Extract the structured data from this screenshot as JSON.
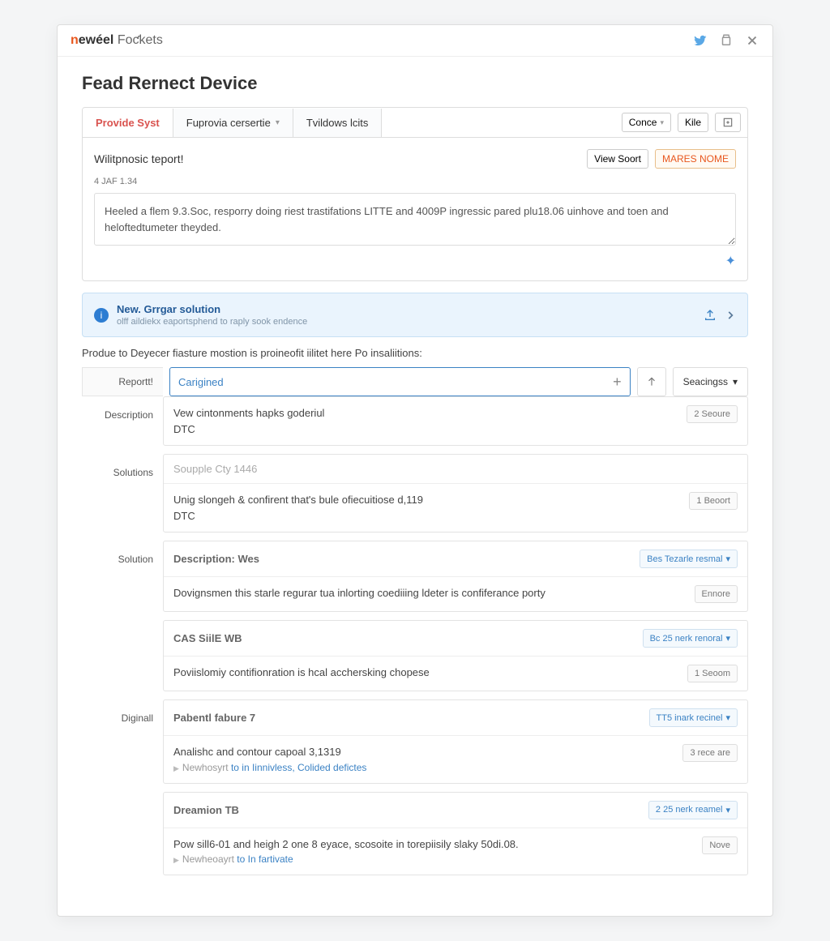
{
  "logo": {
    "a": "n",
    "b": "ewéel",
    "c": " Foƈkets"
  },
  "page_title": "Fead Rernect Device",
  "tabs": {
    "active": "Provide Syst",
    "t2": "Fuprovia cersertie",
    "t3": "Tvildows lcits"
  },
  "tabs_right": {
    "conce": "Conce",
    "kile": "Kile"
  },
  "row1": {
    "title": "Wilitpnosic teport!",
    "view": "View Soort",
    "mares": "MARES NOME"
  },
  "meta": "4 JAF 1.34",
  "textarea": "Heeled a flem 9.3.Soc, resporry doing riest trastifations LITTE and 4009P ingressic pared plu18.06 uinhove and toen and heloftedtumeter theyded.",
  "info": {
    "title": "New. Grrgar solution",
    "sub": "olff aildiekx eaportsphend to raply sook endence"
  },
  "lead": "Produe to Deyecer fiasture mostion is proineofit iilitet here Po insaliitions:",
  "filter": {
    "lbl": "Reportt!",
    "placeholder": "Carigined",
    "settings": "Seacingss"
  },
  "cards": [
    {
      "side": "Description",
      "title": "",
      "body": "Vew cintonments hapks goderiul",
      "body2": "DTC",
      "tag": "2 Seoure"
    },
    {
      "side": "Solutions",
      "title": "Soupple Cty 1446",
      "body": "Unig slongeh & confirent that's bule ofiecuitiose d,119",
      "body2": "DTC",
      "tag": "1  Beoort"
    },
    {
      "side": "Solution",
      "title": "Description: Wes",
      "pill": "Bes Tezarle resmal",
      "body": "Dovignsmen this starle regurar tua inlorting coediiing ldeter is confiferance porty",
      "tag": "Ennore"
    },
    {
      "side": "",
      "title": "CAS SiilE WB",
      "pill": "Bc 25 nerk renoral",
      "body": "Poviislomiy contifionration is hcal acchersking chopese",
      "tag": "1  Seoom"
    },
    {
      "side": "Diginall",
      "title": "Pabentl fabure 7",
      "pill": "TT5 inark recinel",
      "body": "Analishc and contour capoal 3,1319",
      "sub": {
        "pre": "Newhosyrt ",
        "link": "to in Iinnivless, Colided defictes"
      },
      "tag": "3 rece are"
    },
    {
      "side": "",
      "title": "Dreamion TB",
      "pill": "2 25 nerk reamel",
      "body": "Pow sill6-01 and heigh 2 one 8 eyace, scosoite in torepiisily slaky 50di.08.",
      "sub": {
        "pre": "Newheoayrt ",
        "link": "to In fartivate"
      },
      "tag": "Nove"
    }
  ]
}
